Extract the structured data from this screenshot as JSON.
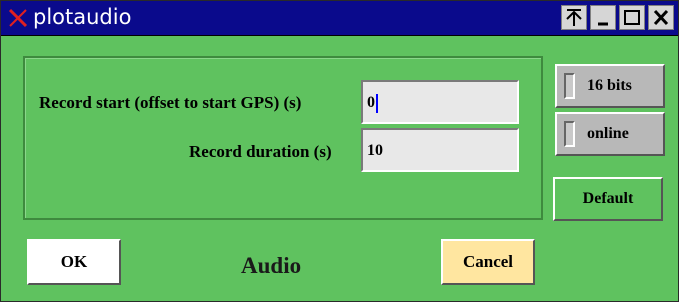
{
  "window": {
    "title": "plotaudio",
    "controls": [
      "pin",
      "minimize",
      "maximize",
      "close"
    ]
  },
  "form": {
    "record_start_label": "Record start (offset to start GPS) (s)",
    "record_start_value": "0",
    "record_duration_label": "Record duration (s)",
    "record_duration_value": "10"
  },
  "options": {
    "bits_label": "16 bits",
    "online_label": "online",
    "default_label": "Default"
  },
  "footer": {
    "ok_label": "OK",
    "heading": "Audio",
    "cancel_label": "Cancel"
  },
  "colors": {
    "background": "#5fc25f",
    "titlebar": "#0a0a8c",
    "cancel": "#ffe6a0",
    "field": "#e8e8e8",
    "toggle": "#b8b8b8",
    "caret": "#0000ff"
  },
  "icons": [
    "x-logo-icon",
    "pin-icon",
    "minimize-icon",
    "maximize-icon",
    "close-icon"
  ]
}
